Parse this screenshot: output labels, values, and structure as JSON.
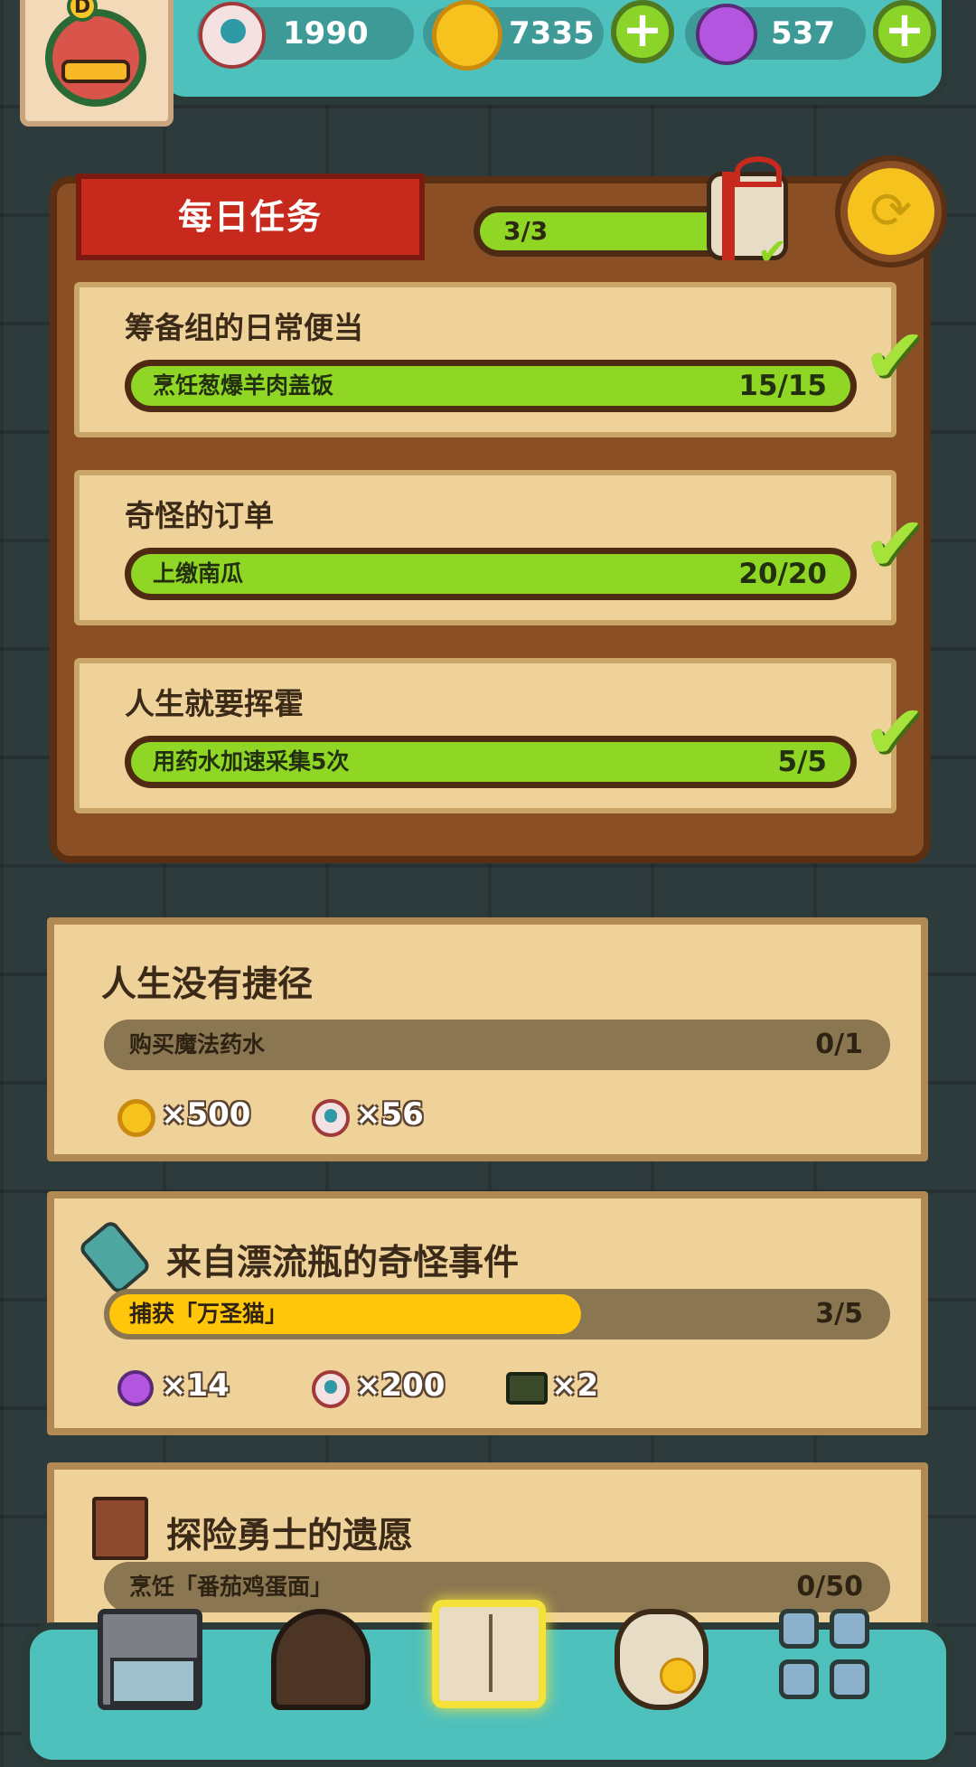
{
  "header": {
    "avatar_badge": "D",
    "resources": [
      {
        "icon": "eyeball-icon",
        "value": "1990"
      },
      {
        "icon": "gold-coin-icon",
        "value": "7335"
      },
      {
        "icon": "potion-icon",
        "value": "537"
      }
    ],
    "plus_symbol": "+"
  },
  "daily": {
    "title": "每日任务",
    "progress": "3/3",
    "progress_fraction": 1.0,
    "refresh_symbol": "⟳",
    "tasks": [
      {
        "title": "筹备组的日常便当",
        "label": "烹饪葱爆羊肉盖饭",
        "count": "15/15",
        "fraction": 1.0
      },
      {
        "title": "奇怪的订单",
        "label": "上缴南瓜",
        "count": "20/20",
        "fraction": 1.0
      },
      {
        "title": "人生就要挥霍",
        "label": "用药水加速采集5次",
        "count": "5/5",
        "fraction": 1.0
      }
    ],
    "check_symbol": "✔"
  },
  "quests": [
    {
      "title": "人生没有捷径",
      "label": "购买魔法药水",
      "count": "0/1",
      "fraction": 0.0,
      "rewards": [
        {
          "icon": "gold-coin-icon",
          "amount": "×500"
        },
        {
          "icon": "eyeball-icon",
          "amount": "×56"
        }
      ]
    },
    {
      "title": "来自漂流瓶的奇怪事件",
      "icon": "bottle-icon",
      "label": "捕获「万圣猫」",
      "count": "3/5",
      "fraction": 0.6,
      "bar_color": "#ffc60a",
      "rewards": [
        {
          "icon": "potion-icon",
          "amount": "×14"
        },
        {
          "icon": "eyeball-icon",
          "amount": "×200"
        },
        {
          "icon": "chip-card-icon",
          "amount": "×2"
        }
      ]
    },
    {
      "title": "探险勇士的遗愿",
      "icon": "book-icon",
      "label": "烹饪「番茄鸡蛋面」",
      "count": "0/50",
      "fraction": 0.0
    }
  ],
  "bottom_nav": [
    {
      "icon": "shop-building-icon"
    },
    {
      "icon": "monster-torch-icon"
    },
    {
      "icon": "open-book-icon",
      "selected": true
    },
    {
      "icon": "money-bag-icon"
    },
    {
      "icon": "grid-menu-icon"
    }
  ],
  "colors": {
    "accent_teal": "#4fc1bd",
    "progress_green": "#8fd625",
    "progress_yellow": "#ffc60a",
    "banner_red": "#c72a1c"
  }
}
